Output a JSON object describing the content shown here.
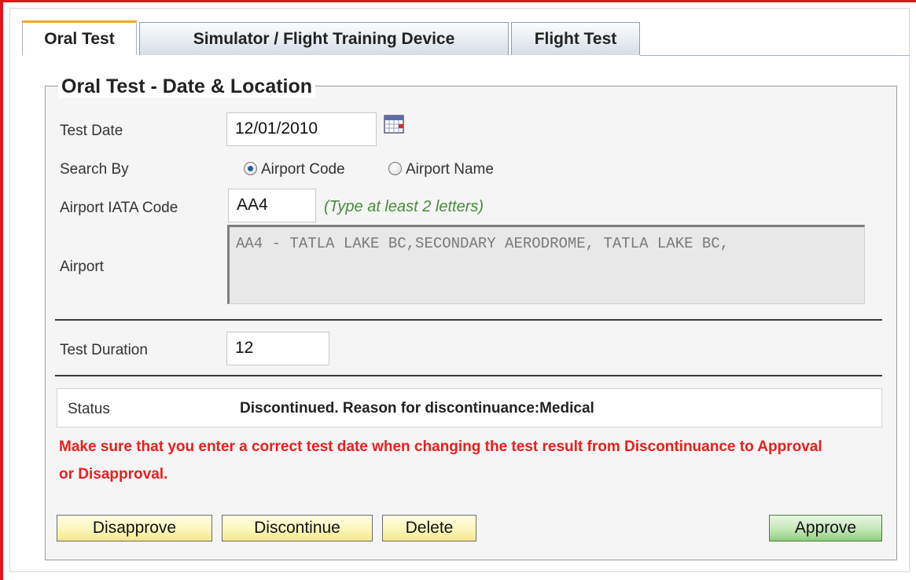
{
  "tabs": [
    {
      "label": "Oral Test",
      "active": true
    },
    {
      "label": "Simulator / Flight Training Device",
      "active": false
    },
    {
      "label": "Flight Test",
      "active": false
    }
  ],
  "section": {
    "legend": "Oral Test - Date & Location"
  },
  "test_date": {
    "label": "Test Date",
    "value": "12/01/2010",
    "icon": "calendar-icon"
  },
  "search_by": {
    "label": "Search By",
    "options": [
      "Airport Code",
      "Airport Name"
    ],
    "selected": "Airport Code"
  },
  "airport_code": {
    "label": "Airport IATA Code",
    "value": "AA4",
    "hint": "(Type at least 2 letters)"
  },
  "airport": {
    "label": "Airport",
    "value": "AA4 - TATLA LAKE BC,SECONDARY AERODROME, TATLA LAKE BC,"
  },
  "test_duration": {
    "label": "Test Duration",
    "value": "12"
  },
  "status": {
    "label": "Status",
    "value": "Discontinued. Reason for discontinuance:Medical"
  },
  "warning": "Make sure that you enter a correct test date when changing the test result from Discontinuance to Approval or Disapproval.",
  "buttons": {
    "disapprove": "Disapprove",
    "discontinue": "Discontinue",
    "delete": "Delete",
    "approve": "Approve"
  },
  "colors": {
    "frame_red": "#e0141b",
    "active_tab_accent": "#f2a81d",
    "hint_green": "#4a8a3e",
    "warning_red": "#ee1c1c",
    "approve_green": "#bfe5b2",
    "button_yellow": "#fbf5b7"
  }
}
